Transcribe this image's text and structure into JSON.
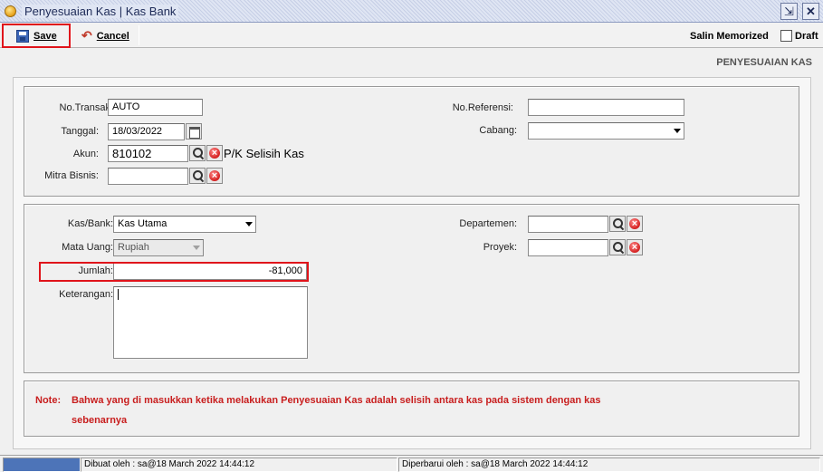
{
  "window": {
    "title": "Penyesuaian Kas | Kas Bank"
  },
  "toolbar": {
    "save_label": "Save",
    "cancel_label": "Cancel",
    "salin_memorized_label": "Salin Memorized",
    "draft_label": "Draft"
  },
  "header": {
    "section_title": "PENYESUAIAN KAS"
  },
  "form": {
    "no_transaksi_label": "No.Transaksi:",
    "no_transaksi_value": "AUTO",
    "tanggal_label": "Tanggal:",
    "tanggal_value": "18/03/2022",
    "akun_label": "Akun:",
    "akun_value": "810102",
    "akun_name": "P/K Selisih Kas",
    "mitra_bisnis_label": "Mitra Bisnis:",
    "mitra_bisnis_value": "",
    "no_referensi_label": "No.Referensi:",
    "no_referensi_value": "",
    "cabang_label": "Cabang:",
    "cabang_value": ""
  },
  "detail": {
    "kas_bank_label": "Kas/Bank:",
    "kas_bank_value": "Kas Utama",
    "mata_uang_label": "Mata Uang:",
    "mata_uang_value": "Rupiah",
    "jumlah_label": "Jumlah:",
    "jumlah_value": "-81,000",
    "keterangan_label": "Keterangan:",
    "keterangan_value": "",
    "departemen_label": "Departemen:",
    "departemen_value": "",
    "proyek_label": "Proyek:",
    "proyek_value": ""
  },
  "note": {
    "label": "Note:",
    "line1": "Bahwa yang di masukkan ketika melakukan Penyesuaian Kas adalah selisih antara kas pada sistem dengan kas",
    "line2": "sebenarnya"
  },
  "status": {
    "created": "Dibuat oleh : sa@18 March 2022  14:44:12",
    "updated": "Diperbarui oleh : sa@18 March 2022  14:44:12"
  },
  "colors": {
    "highlight": "#e0141b",
    "note_text": "#c81e1e",
    "title_text": "#1d2a57"
  },
  "icons": [
    "window-app-icon",
    "restore-icon",
    "close-icon",
    "save-icon",
    "cancel-icon",
    "calendar-icon",
    "search-icon",
    "clear-icon",
    "chevron-down-icon"
  ]
}
